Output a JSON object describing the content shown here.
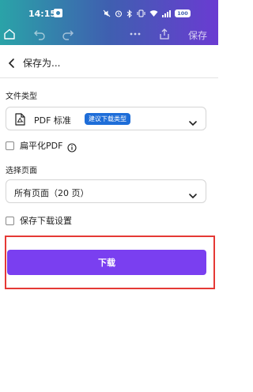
{
  "status_bar": {
    "time": "14:15",
    "battery": "100",
    "icons": [
      "app-icon",
      "mute-icon",
      "alarm-icon",
      "bluetooth-icon",
      "vibrate-icon",
      "wifi-icon",
      "signal-icon",
      "battery-icon"
    ]
  },
  "toolbar": {
    "save_label": "保存",
    "icons": [
      "home-icon",
      "undo-icon",
      "redo-icon",
      "more-icon",
      "share-icon"
    ]
  },
  "header": {
    "title": "保存为..."
  },
  "file_type": {
    "label": "文件类型",
    "selected": "PDF 标准",
    "badge": "建议下载类型"
  },
  "flatten_pdf": {
    "label": "扁平化PDF",
    "checked": false
  },
  "pages": {
    "label": "选择页面",
    "selected": "所有页面（20 页）"
  },
  "save_settings": {
    "label": "保存下载设置",
    "checked": false
  },
  "download_button": {
    "label": "下载"
  },
  "colors": {
    "accent": "#7a3ff0",
    "badge": "#1e6dd8",
    "highlight": "#e53935",
    "gradient_start": "#2aa3a8",
    "gradient_end": "#6a3bd2"
  }
}
